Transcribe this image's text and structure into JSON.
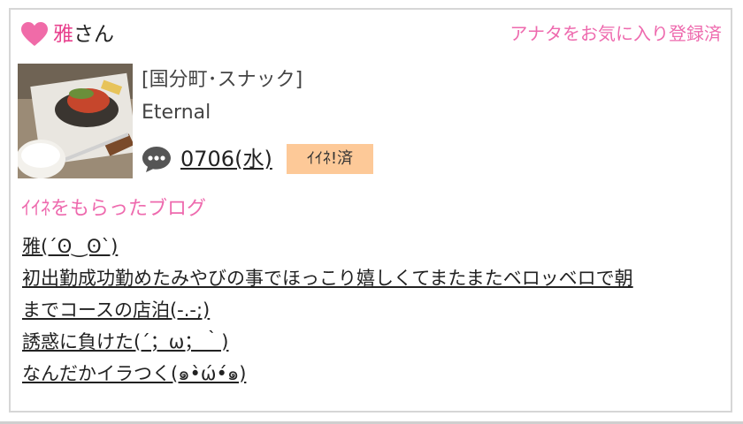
{
  "header": {
    "name_given": "雅",
    "name_suffix": "さん",
    "favorite_status": "アナタをお気に入り登録済"
  },
  "profile": {
    "category": "[国分町･スナック]",
    "shop_name": "Eternal",
    "date_link": "0706(水)",
    "like_badge": "ｲｲﾈ!済"
  },
  "blog_section": {
    "title": "ｲｲﾈをもらったブログ",
    "items": [
      "雅(´ʘ‿ʘ`)",
      "初出勤成功勤めたみやびの事でほっこり嬉しくてまたまたベロッベロで朝",
      "までコースの店泊(-.-;)",
      "誘惑に負けた(´；ω；｀)",
      "なんだかイラつく(๑•̀ώ•́๑)"
    ]
  },
  "colors": {
    "accent_pink": "#ee6aae",
    "heart_pink": "#f06ba8",
    "badge_bg": "#fdc998"
  },
  "icons": {
    "heart": "heart-icon",
    "chat": "speech-bubble-icon"
  }
}
